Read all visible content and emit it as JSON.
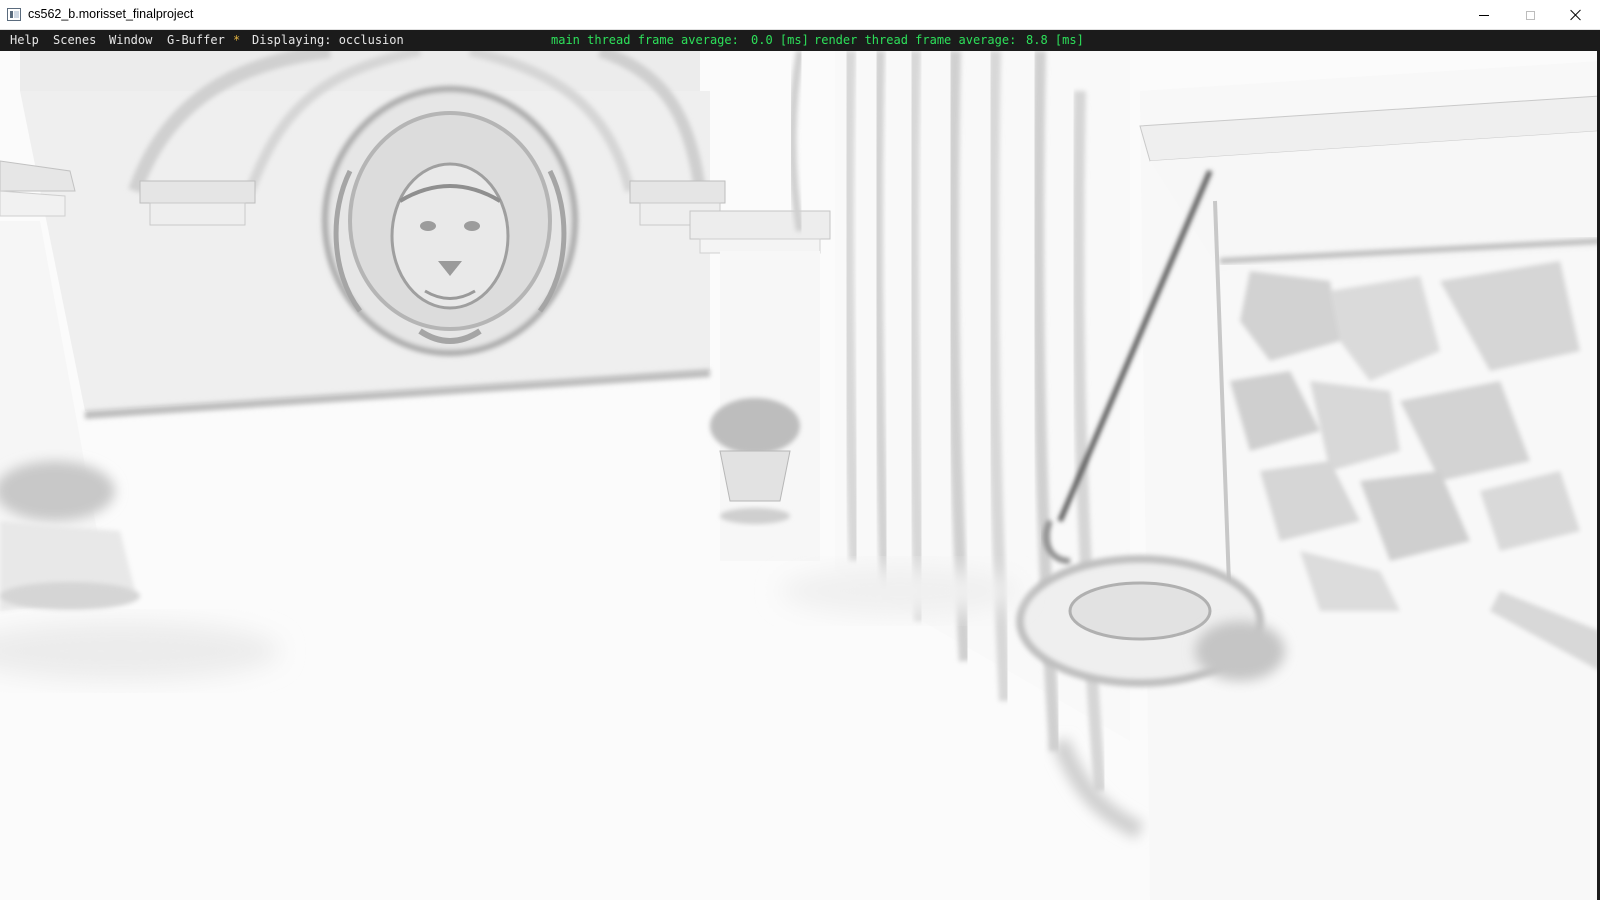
{
  "window": {
    "title": "cs562_b.morisset_finalproject",
    "controls": {
      "minimize": "minimize",
      "maximize": "maximize",
      "close": "close"
    }
  },
  "menu": {
    "items": [
      "Help",
      "Scenes",
      "Window",
      "G-Buffer"
    ],
    "separator": "*",
    "display_mode": "Displaying: occlusion"
  },
  "stats": {
    "main_label": "main thread frame average:",
    "main_value": "0.0 [ms]",
    "render_label": "render thread frame average:",
    "render_value": "8.8 [ms]"
  },
  "viewport": {
    "mode": "occlusion",
    "description_icons": [
      "lion-crest-relief",
      "archway",
      "pillar",
      "curtain",
      "hanging-basket",
      "potted-plant"
    ]
  },
  "colors": {
    "menubar_bg": "#1b1b1b",
    "menu_text": "#e6e6e6",
    "stats_text": "#2de05a",
    "separator": "#e3b341",
    "viewport_bg": "#fbfbfb"
  }
}
